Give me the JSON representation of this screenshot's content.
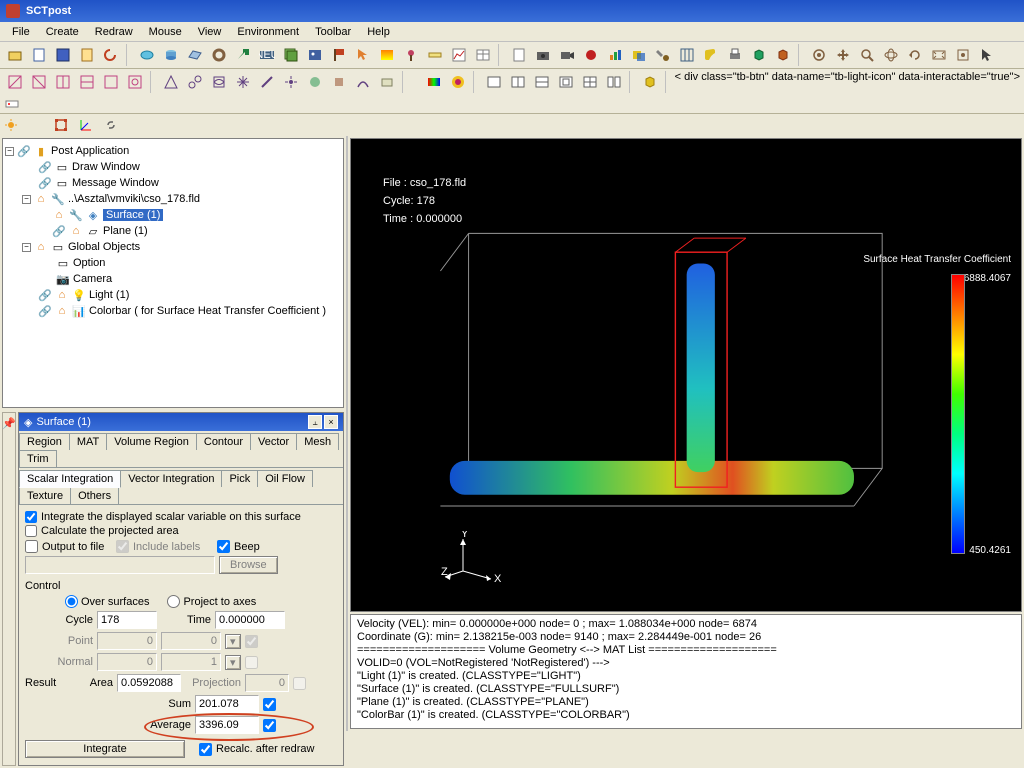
{
  "app": {
    "title": "SCTpost"
  },
  "menu": [
    "File",
    "Create",
    "Redraw",
    "Mouse",
    "View",
    "Environment",
    "Toolbar",
    "Help"
  ],
  "tree": {
    "n0": "Post Application",
    "n1": "Draw Window",
    "n2": "Message Window",
    "n3": "..\\Asztal\\vmviki\\cso_178.fld",
    "n4": "Surface (1)",
    "n5": "Plane (1)",
    "n6": "Global Objects",
    "n7": "Option",
    "n8": "Camera",
    "n9": "Light (1)",
    "n10": "Colorbar ( for Surface Heat Transfer Coefficient )"
  },
  "panel": {
    "title": "Surface (1)",
    "tabs_top": [
      "Region",
      "MAT",
      "Volume Region",
      "Contour",
      "Vector",
      "Mesh",
      "Trim"
    ],
    "tabs_bot": [
      "Scalar Integration",
      "Vector Integration",
      "Pick",
      "Oil Flow",
      "Texture",
      "Others"
    ],
    "chk_integrate": "Integrate the displayed scalar variable on this surface",
    "chk_projarea": "Calculate the projected area",
    "chk_output": "Output to file",
    "chk_incl": "Include labels",
    "chk_beep": "Beep",
    "browse": "Browse",
    "control": "Control",
    "over": "Over surfaces",
    "proj": "Project to axes",
    "cycle_lbl": "Cycle",
    "cycle_val": "178",
    "time_lbl": "Time",
    "time_val": "0.000000",
    "point_lbl": "Point",
    "point_v1": "0",
    "point_v2": "0",
    "normal_lbl": "Normal",
    "normal_v1": "0",
    "normal_v2": "1",
    "result": "Result",
    "area_lbl": "Area",
    "area_val": "0.0592088",
    "projres_lbl": "Projection",
    "projres_val": "0",
    "sum_lbl": "Sum",
    "sum_val": "201.078",
    "avg_lbl": "Average",
    "avg_val": "3396.09",
    "integrate_btn": "Integrate",
    "recalc": "Recalc. after redraw"
  },
  "viewport": {
    "line1": "File : cso_178.fld",
    "line2": "Cycle: 178",
    "line3": "Time : 0.000000",
    "legend_title": "Surface Heat Transfer Coefficient",
    "legend_max": "6888.4067",
    "legend_min": "450.4261",
    "axis_x": "X",
    "axis_y": "Y",
    "axis_z": "Z"
  },
  "console": {
    "l1": "Velocity (VEL): min= 0.000000e+000  node= 0 ; max= 1.088034e+000  node= 6874",
    "l2": "Coordinate (G): min= 2.138215e-003  node= 9140 ; max= 2.284449e-001  node= 26",
    "l3": "==================== Volume Geometry <--> MAT List ====================",
    "l4": "VOLID=0 (VOL=NotRegistered 'NotRegistered') --->",
    "l5": "\"Light (1)\" is created. (CLASSTYPE=\"LIGHT\")",
    "l6": "\"Surface (1)\" is created. (CLASSTYPE=\"FULLSURF\")",
    "l7": "\"Plane (1)\" is created. (CLASSTYPE=\"PLANE\")",
    "l8": "\"ColorBar (1)\" is created. (CLASSTYPE=\"COLORBAR\")"
  },
  "chart_data": {
    "type": "heatmap",
    "title": "Surface Heat Transfer Coefficient",
    "colorbar_range": [
      450.4261,
      6888.4067
    ],
    "file": "cso_178.fld",
    "cycle": 178,
    "time": 0.0
  }
}
